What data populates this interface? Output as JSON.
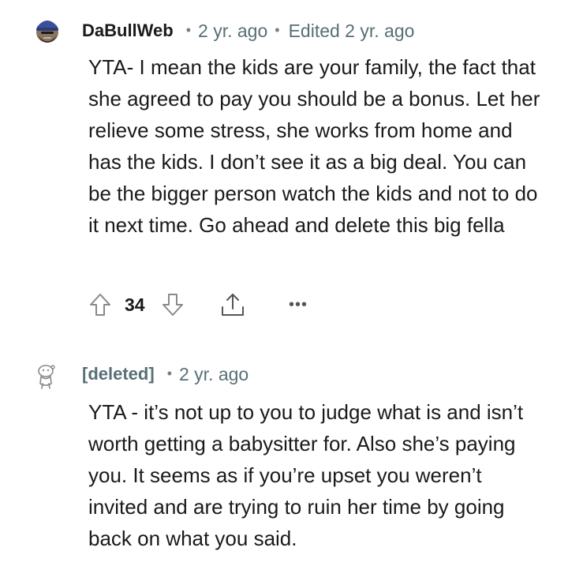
{
  "comments": [
    {
      "username": "DaBullWeb",
      "separator": "•",
      "time": "2 yr. ago",
      "edited": "Edited 2 yr. ago",
      "body": "YTA- I mean the kids are your family, the fact that she agreed to pay you should be a bonus. Let her relieve some stress, she works from home and has the kids. I don’t see it as a big deal. You can be the bigger person watch the kids and not to do it next time. Go ahead and delete this big fella",
      "score": "34",
      "icons": [
        "avatar-bearded-man-icon",
        "upvote-arrow-icon",
        "downvote-arrow-icon",
        "share-icon",
        "more-options-icon"
      ],
      "more_label": "•••"
    },
    {
      "username": "[deleted]",
      "separator": "•",
      "time": "2 yr. ago",
      "body": "YTA - it’s not up to you to judge what is and isn’t worth getting a babysitter for. Also she’s paying you. It seems as if you’re upset you weren’t invited and are trying to ruin her time by going back on what you said.",
      "icons": [
        "deleted-user-avatar-icon"
      ]
    }
  ],
  "colors": {
    "text": "#1a1a1b",
    "meta": "#576f76",
    "icon": "#878a8c"
  }
}
